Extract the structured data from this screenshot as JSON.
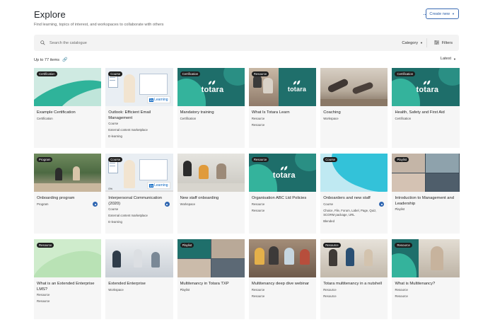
{
  "header": {
    "title": "Explore",
    "subtitle": "Find learning, topics of interest, and workspaces to collaborate with others",
    "more_label": "···",
    "create_label": "Create new"
  },
  "search": {
    "placeholder": "Search the catalogue",
    "category_label": "Category",
    "filters_label": "Filters"
  },
  "results": {
    "count_label": "Up to 77 items",
    "sort_label": "Latest"
  },
  "colors": {
    "accent": "#2a5ea8",
    "totara_teal": "#1f6f6b",
    "mint": "#cbe9e0"
  },
  "cards": [
    {
      "badge": "Certification",
      "title": "Example Certification",
      "meta": [
        "Certification"
      ],
      "thumb": "mint"
    },
    {
      "badge": "Course",
      "title": "Outlook: Efficient Email Management",
      "meta": [
        "Course",
        "External content marketplace",
        "E-learning"
      ],
      "thumb": "linkedin"
    },
    {
      "badge": "Certification",
      "title": "Mandatory training",
      "meta": [
        "Certification"
      ],
      "thumb": "totara"
    },
    {
      "badge": "Resource",
      "title": "What Is Totara Learn",
      "meta": [
        "Resource",
        "Resource"
      ],
      "thumb": "totara-photo"
    },
    {
      "badge": "",
      "title": "Coaching",
      "meta": [
        "Workspace"
      ],
      "thumb": "yoga"
    },
    {
      "badge": "Certification",
      "title": "Health, Safety and First Aid",
      "meta": [
        "Certification"
      ],
      "thumb": "totara"
    },
    {
      "badge": "Program",
      "title": "Onboarding program",
      "meta": [
        "Program"
      ],
      "thumb": "garden",
      "action": true
    },
    {
      "badge": "Course",
      "title": "Interpersonal Communication (2020)",
      "meta": [
        "Course",
        "External content marketplace",
        "E-learning"
      ],
      "thumb": "linkedin2",
      "action": true,
      "progress": "0%"
    },
    {
      "badge": "",
      "title": "New staff onboarding",
      "meta": [
        "Workspace"
      ],
      "thumb": "office"
    },
    {
      "badge": "Resource",
      "title": "Organisation ABC Ltd Policies",
      "meta": [
        "Resource",
        "Resource"
      ],
      "thumb": "totara"
    },
    {
      "badge": "Course",
      "title": "Onboarders and new staff",
      "meta": [
        "Course",
        "Choice, File, Forum, Label, Page, Quiz, SCORM package, URL",
        "Blended"
      ],
      "thumb": "aqua",
      "action": true
    },
    {
      "badge": "Playlist",
      "title": "Introduction to Management and Leadership",
      "meta": [
        "Playlist"
      ],
      "thumb": "collage"
    },
    {
      "badge": "Resource",
      "title": "What is an Extended Enterprise LMS?",
      "meta": [
        "Resource",
        "Resource"
      ],
      "thumb": "lightgreen"
    },
    {
      "badge": "",
      "title": "Extended Enterprise",
      "meta": [
        "Workspace"
      ],
      "thumb": "meeting"
    },
    {
      "badge": "Playlist",
      "title": "Multitenancy in Totara TXP",
      "meta": [
        "Playlist"
      ],
      "thumb": "collage2"
    },
    {
      "badge": "",
      "title": "Multitenancy deep dive webinar",
      "meta": [
        "Resource",
        "Resource"
      ],
      "thumb": "group"
    },
    {
      "badge": "Resource",
      "title": "Totara multitenancy in a nutshell",
      "meta": [
        "Resource",
        "Resource"
      ],
      "thumb": "team"
    },
    {
      "badge": "Resource",
      "title": "What is Multitenancy?",
      "meta": [
        "Resource",
        "Resource"
      ],
      "thumb": "woman"
    }
  ]
}
